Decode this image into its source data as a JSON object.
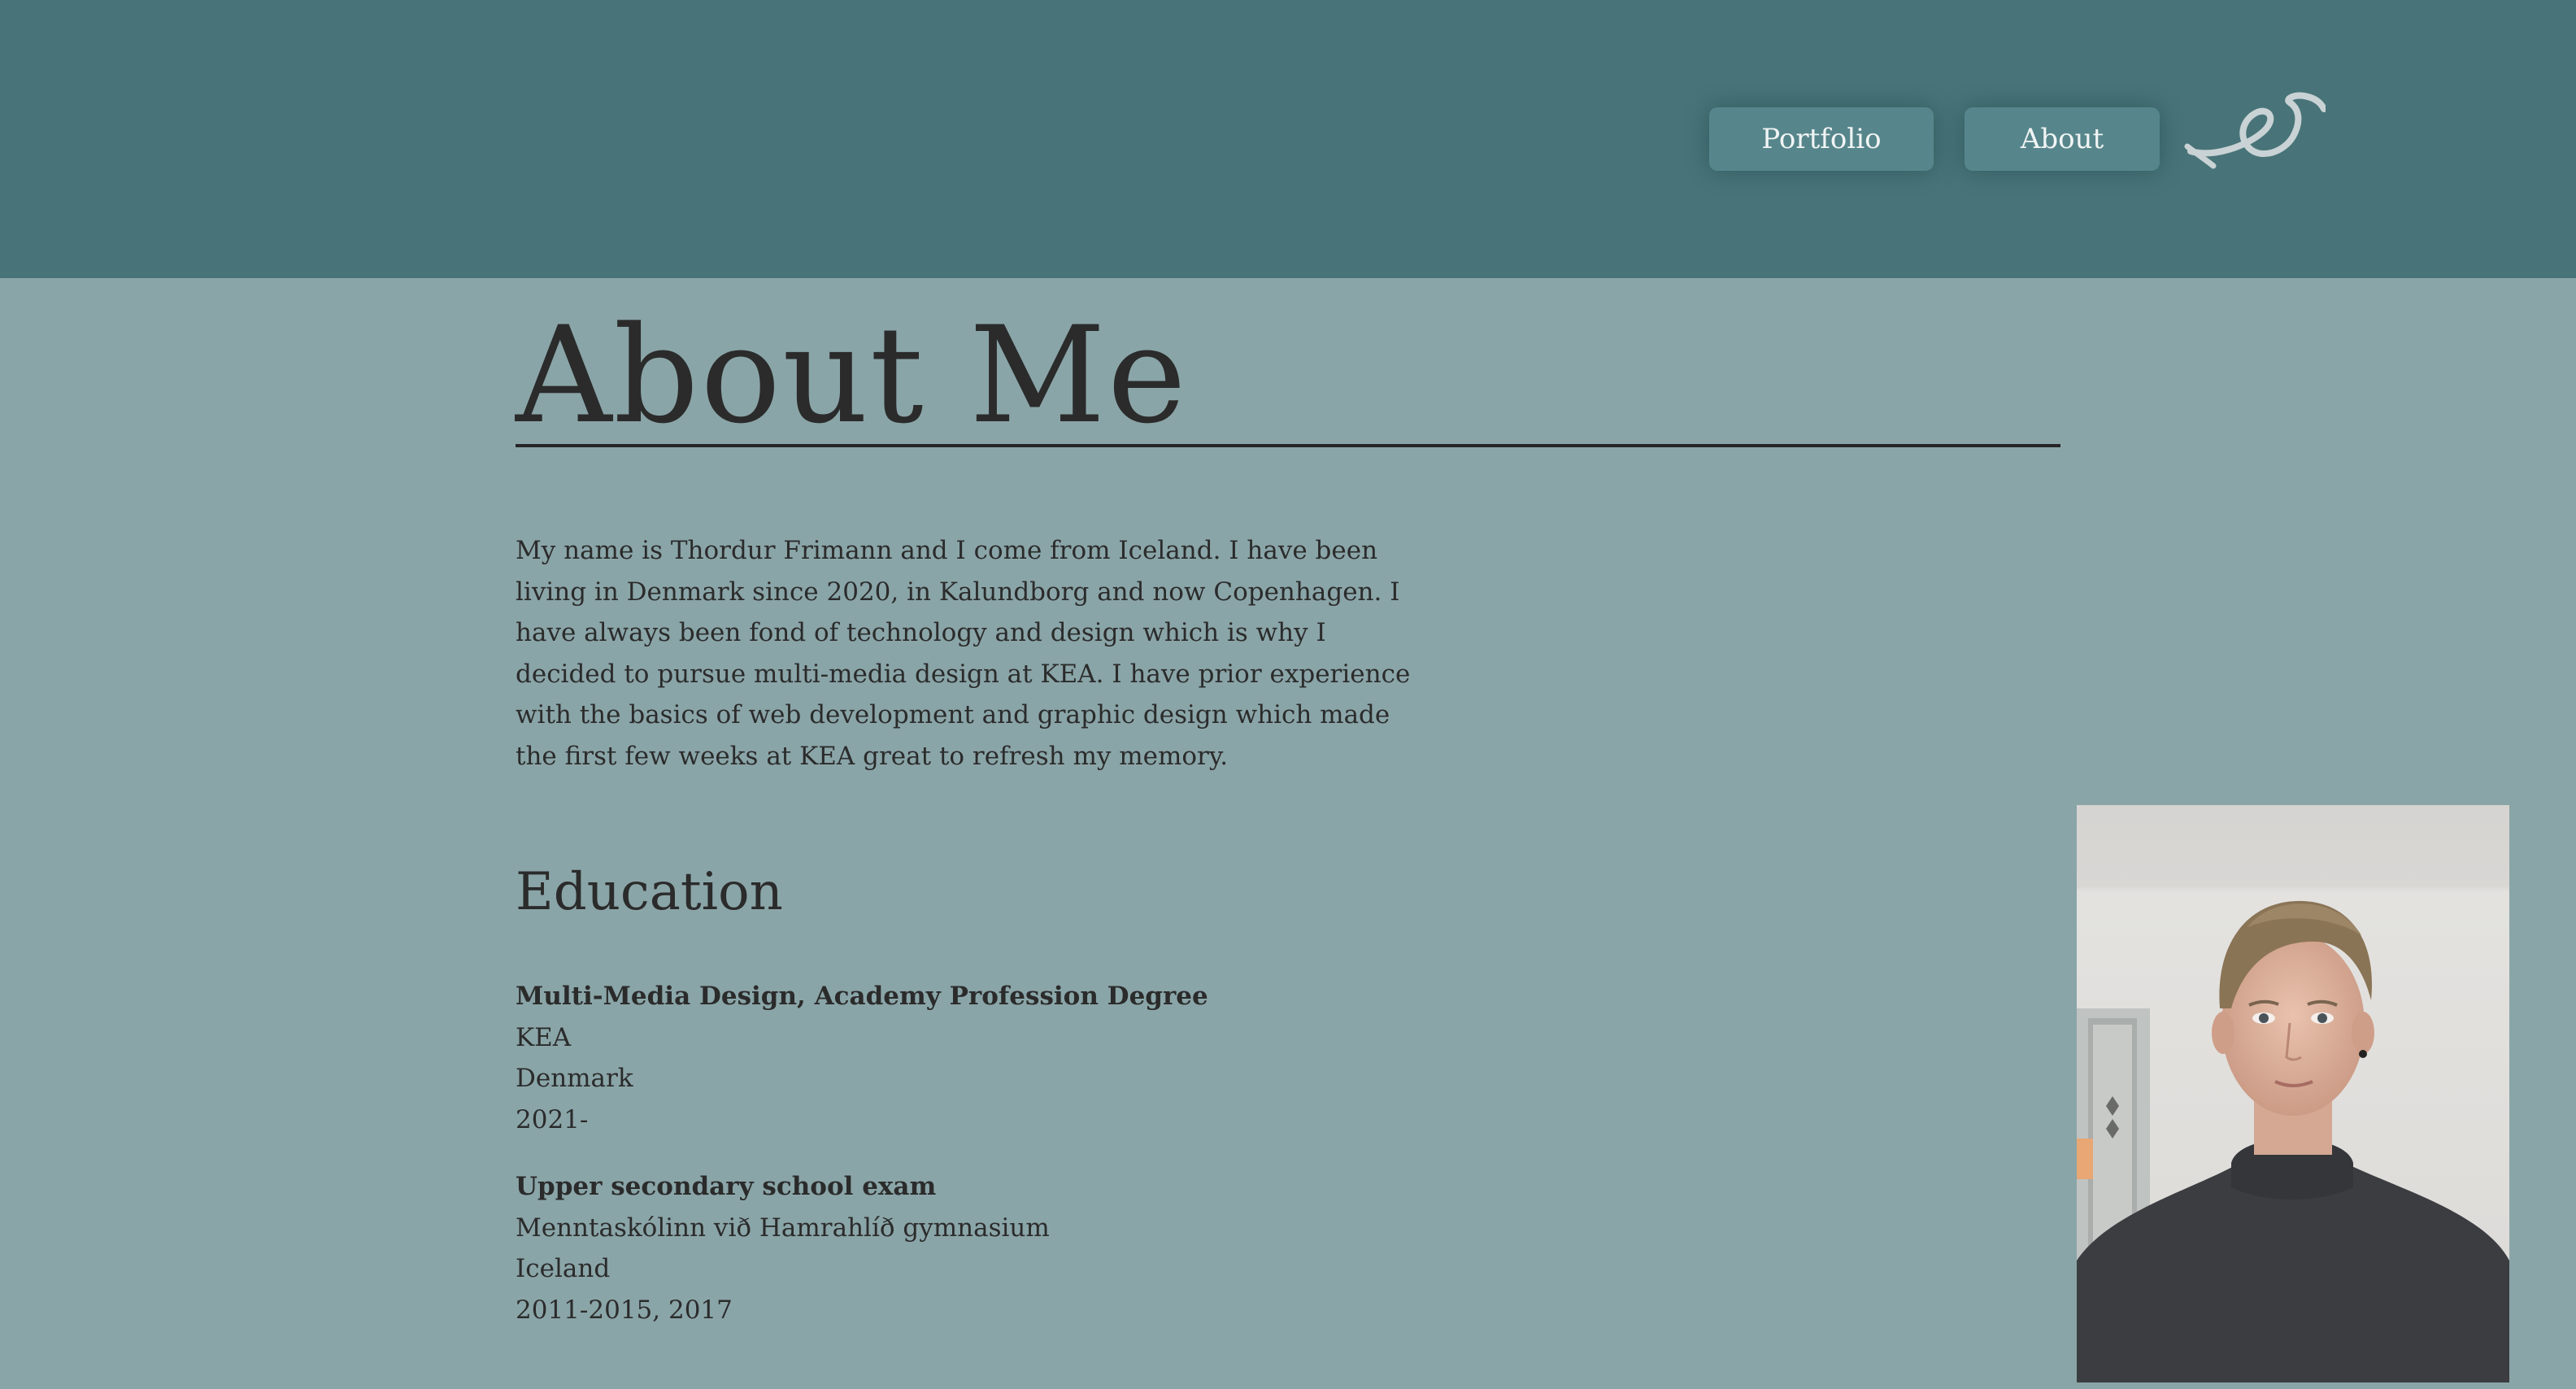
{
  "nav": {
    "portfolio_label": "Portfolio",
    "about_label": "About",
    "logo_icon": "signature-logo-icon"
  },
  "main": {
    "title": "About Me",
    "bio": "My name is Thordur Frimann and I come from Iceland. I have been living in Denmark since 2020, in Kalundborg and now Copenhagen. I have always been fond of technology and design which is why I decided to pursue multi-media design at KEA. I have prior experience with the basics of web development and graphic design which made the first few weeks at KEA great to refresh my memory.",
    "education": {
      "heading": "Education",
      "entries": [
        {
          "degree": "Multi-Media Design, Academy Profession Degree",
          "school": "KEA",
          "country": "Denmark",
          "years": "2021-"
        },
        {
          "degree": "Upper secondary school exam",
          "school": "Menntaskólinn við Hamrahlíð gymnasium",
          "country": "Iceland",
          "years": "2011-2015, 2017"
        }
      ]
    },
    "photo": {
      "icon": "portrait-photo"
    }
  },
  "colors": {
    "header_bg": "#487479",
    "page_bg": "#8aa5a8",
    "button_bg": "#56868b",
    "text": "#2b2b2b"
  }
}
